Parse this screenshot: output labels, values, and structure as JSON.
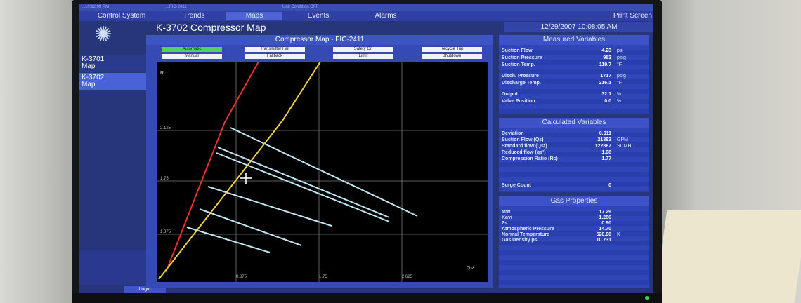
{
  "nav": {
    "control_system": "Control System",
    "trends": "Trends",
    "maps": "Maps",
    "events": "Events",
    "alarms": "Alarms",
    "print_screen": "Print Screen"
  },
  "status_strip": [
    "...10:12:09 PM",
    "...FIC-2411",
    "Unit Condition OFF"
  ],
  "page_title": "K-3702 Compressor  Map",
  "datetime": "12/29/2007 10:08:05 AM",
  "sidebar": {
    "items": [
      {
        "line1": "K-3701",
        "line2": "Map"
      },
      {
        "line1": "K-3702",
        "line2": "Map"
      }
    ],
    "login_label": "Login"
  },
  "map": {
    "title": "Compressor Map - FIC-2411",
    "buttons": {
      "automatic": "Automatic",
      "manual": "Manual",
      "transmitter_fail": "Transmitter Fail",
      "fallback": "Fallback",
      "safety_on": "Safety On",
      "limit": "Limit",
      "recycle_trip": "Recycle Trip",
      "shutdown": "Shutdown"
    },
    "y_axis_label": "Rc",
    "x_axis_label": "Qs²",
    "y_ticks": [
      "2.125",
      "1.75",
      "1.375"
    ],
    "x_ticks": [
      "0.875",
      "1.75",
      "2.625"
    ],
    "colors": {
      "surge_line": "#e8322a",
      "control_line": "#f2d23a",
      "speed_lines": "#bfe6f2"
    }
  },
  "measured": {
    "title": "Measured Variables",
    "rows": [
      {
        "label": "Suction Flow",
        "value": "4.23",
        "unit": "psi"
      },
      {
        "label": "Suction Pressure",
        "value": "953",
        "unit": "psig"
      },
      {
        "label": "Suction Temp.",
        "value": "119.7",
        "unit": "°F"
      },
      {
        "label": "Disch. Pressure",
        "value": "1717",
        "unit": "psig"
      },
      {
        "label": "Discharge Temp.",
        "value": "216.1",
        "unit": "°F"
      },
      {
        "label": "Output",
        "value": "32.1",
        "unit": "%"
      },
      {
        "label": "Valve Position",
        "value": "0.0",
        "unit": "%"
      }
    ]
  },
  "calculated": {
    "title": "Calculated Variables",
    "rows": [
      {
        "label": "Deviation",
        "value": "0.011",
        "unit": ""
      },
      {
        "label": "Suction Flow (Qs)",
        "value": "21863",
        "unit": "GPM"
      },
      {
        "label": "Standard flow (Qst)",
        "value": "122867",
        "unit": "SCMH"
      },
      {
        "label": "Reduced flow (qs²)",
        "value": "1.08",
        "unit": ""
      },
      {
        "label": "Compression Ratio (Rc)",
        "value": "1.77",
        "unit": ""
      },
      {
        "label": "Surge Count",
        "value": "0",
        "unit": ""
      }
    ]
  },
  "gas": {
    "title": "Gas Properties",
    "rows": [
      {
        "label": "MW",
        "value": "17.29",
        "unit": ""
      },
      {
        "label": "Kavi",
        "value": "1.280",
        "unit": ""
      },
      {
        "label": "Zs",
        "value": "0.90",
        "unit": ""
      },
      {
        "label": "Atmospheric Pressure",
        "value": "14.70",
        "unit": ""
      },
      {
        "label": "Normal Temperature",
        "value": "520.00",
        "unit": "K"
      },
      {
        "label": "Gas Density ps",
        "value": "10.731",
        "unit": ""
      }
    ]
  }
}
